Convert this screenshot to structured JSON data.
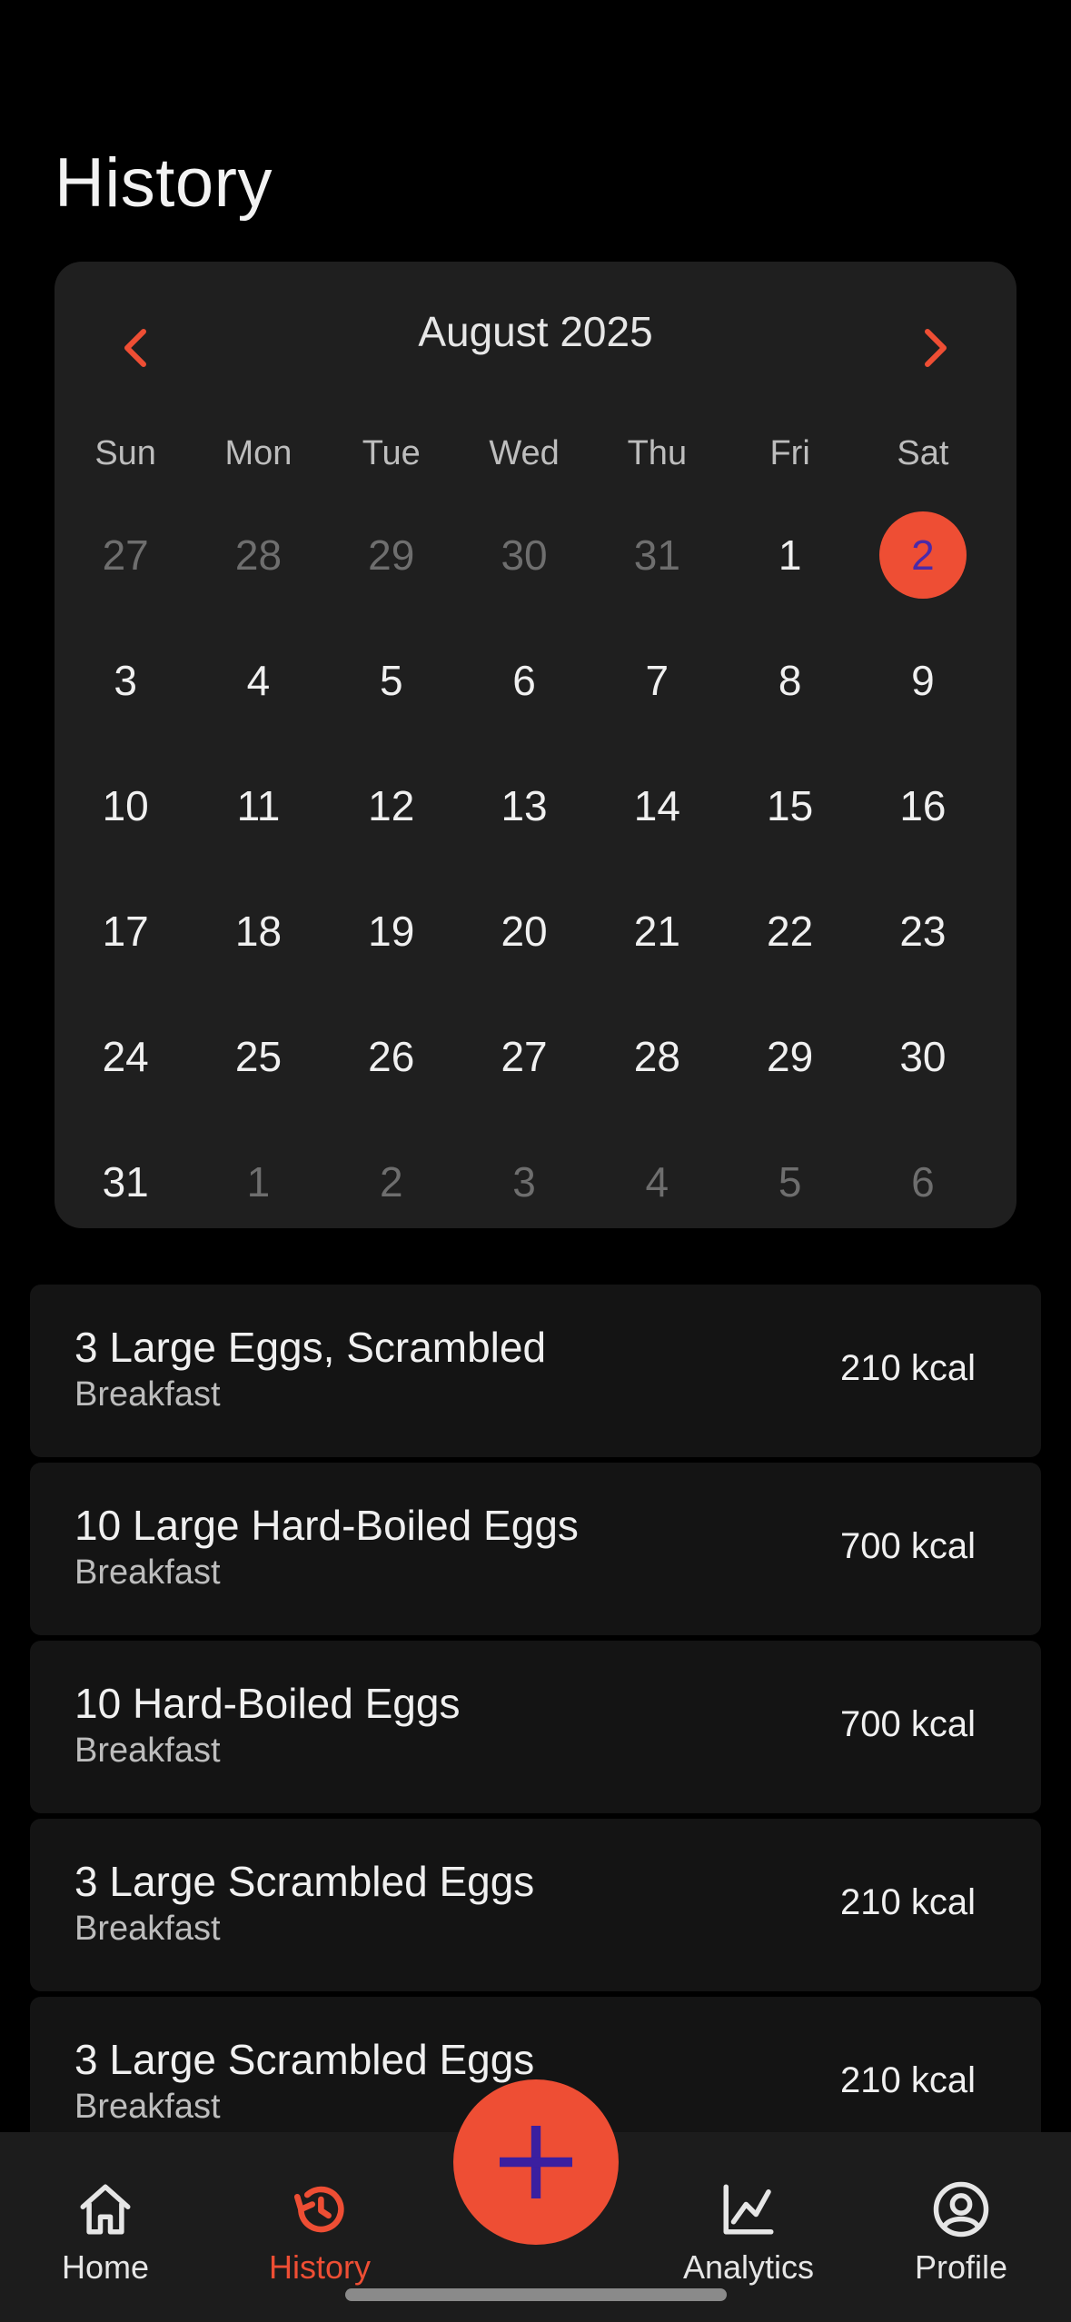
{
  "header": {
    "title": "History"
  },
  "calendar": {
    "month_label": "August 2025",
    "weekdays": [
      "Sun",
      "Mon",
      "Tue",
      "Wed",
      "Thu",
      "Fri",
      "Sat"
    ],
    "weeks": [
      [
        "27",
        "28",
        "29",
        "30",
        "31",
        "1",
        "2"
      ],
      [
        "3",
        "4",
        "5",
        "6",
        "7",
        "8",
        "9"
      ],
      [
        "10",
        "11",
        "12",
        "13",
        "14",
        "15",
        "16"
      ],
      [
        "17",
        "18",
        "19",
        "20",
        "21",
        "22",
        "23"
      ],
      [
        "24",
        "25",
        "26",
        "27",
        "28",
        "29",
        "30"
      ],
      [
        "31",
        "1",
        "2",
        "3",
        "4",
        "5",
        "6"
      ]
    ],
    "selected_date": "2"
  },
  "entries": [
    {
      "name": "3 Large Eggs, Scrambled",
      "meal": "Breakfast",
      "kcal": "210 kcal"
    },
    {
      "name": "10 Large Hard-Boiled Eggs",
      "meal": "Breakfast",
      "kcal": "700 kcal"
    },
    {
      "name": "10 Hard-Boiled Eggs",
      "meal": "Breakfast",
      "kcal": "700 kcal"
    },
    {
      "name": "3 Large Scrambled Eggs",
      "meal": "Breakfast",
      "kcal": "210 kcal"
    },
    {
      "name": "3 Large Scrambled Eggs",
      "meal": "Breakfast",
      "kcal": "210 kcal"
    }
  ],
  "tabbar": {
    "home": "Home",
    "history": "History",
    "analytics": "Analytics",
    "profile": "Profile",
    "active": "history"
  },
  "icons": {
    "prev": "chevron-left-icon",
    "next": "chevron-right-icon",
    "fab": "plus-icon",
    "home": "home-icon",
    "history": "history-icon",
    "analytics": "chart-line-icon",
    "profile": "user-circle-icon"
  },
  "colors": {
    "accent": "#ee4e34",
    "selected_text": "#4b2aa8",
    "background": "#000000",
    "card": "#1f1f1f"
  }
}
